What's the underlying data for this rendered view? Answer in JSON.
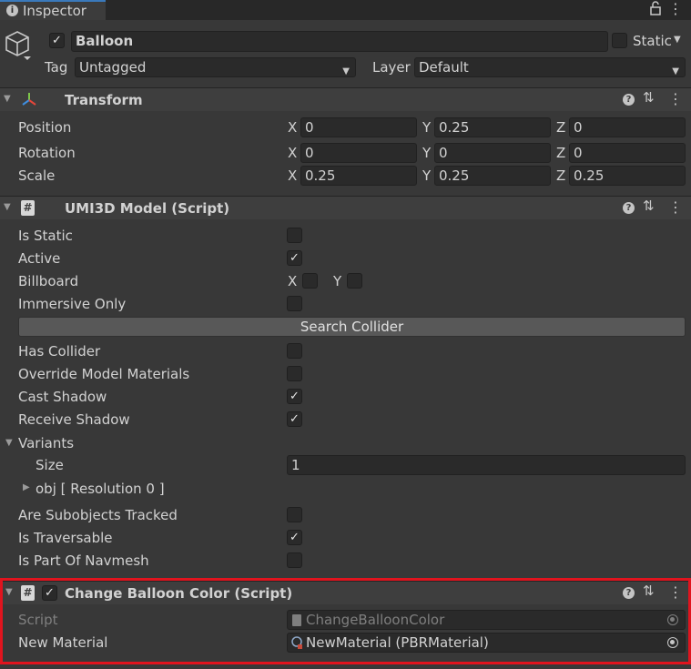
{
  "tab": {
    "title": "Inspector"
  },
  "object": {
    "name": "Balloon",
    "static_label": "Static",
    "tag_label": "Tag",
    "tag_value": "Untagged",
    "layer_label": "Layer",
    "layer_value": "Default"
  },
  "transform": {
    "title": "Transform",
    "rows": [
      {
        "label": "Position",
        "x": "0",
        "y": "0.25",
        "z": "0"
      },
      {
        "label": "Rotation",
        "x": "0",
        "y": "0",
        "z": "0"
      },
      {
        "label": "Scale",
        "x": "0.25",
        "y": "0.25",
        "z": "0.25"
      }
    ],
    "axis_x": "X",
    "axis_y": "Y",
    "axis_z": "Z"
  },
  "model": {
    "title": "UMI3D Model (Script)",
    "is_static": "Is Static",
    "active": "Active",
    "billboard": "Billboard",
    "billboard_x": "X",
    "billboard_y": "Y",
    "immersive_only": "Immersive Only",
    "search_collider": "Search Collider",
    "has_collider": "Has Collider",
    "override_materials": "Override Model Materials",
    "cast_shadow": "Cast Shadow",
    "receive_shadow": "Receive Shadow",
    "variants": "Variants",
    "size": "Size",
    "size_value": "1",
    "obj": "obj [ Resolution 0 ]",
    "subobjects_tracked": "Are Subobjects Tracked",
    "is_traversable": "Is Traversable",
    "is_part_of_navmesh": "Is Part Of Navmesh"
  },
  "balloon": {
    "title": "Change Balloon Color (Script)",
    "script_label": "Script",
    "script_value": "ChangeBalloonColor",
    "material_label": "New Material",
    "material_value": "NewMaterial (PBRMaterial)"
  },
  "colors": {
    "highlight": "#e0141e",
    "accent": "#3a79bb"
  }
}
